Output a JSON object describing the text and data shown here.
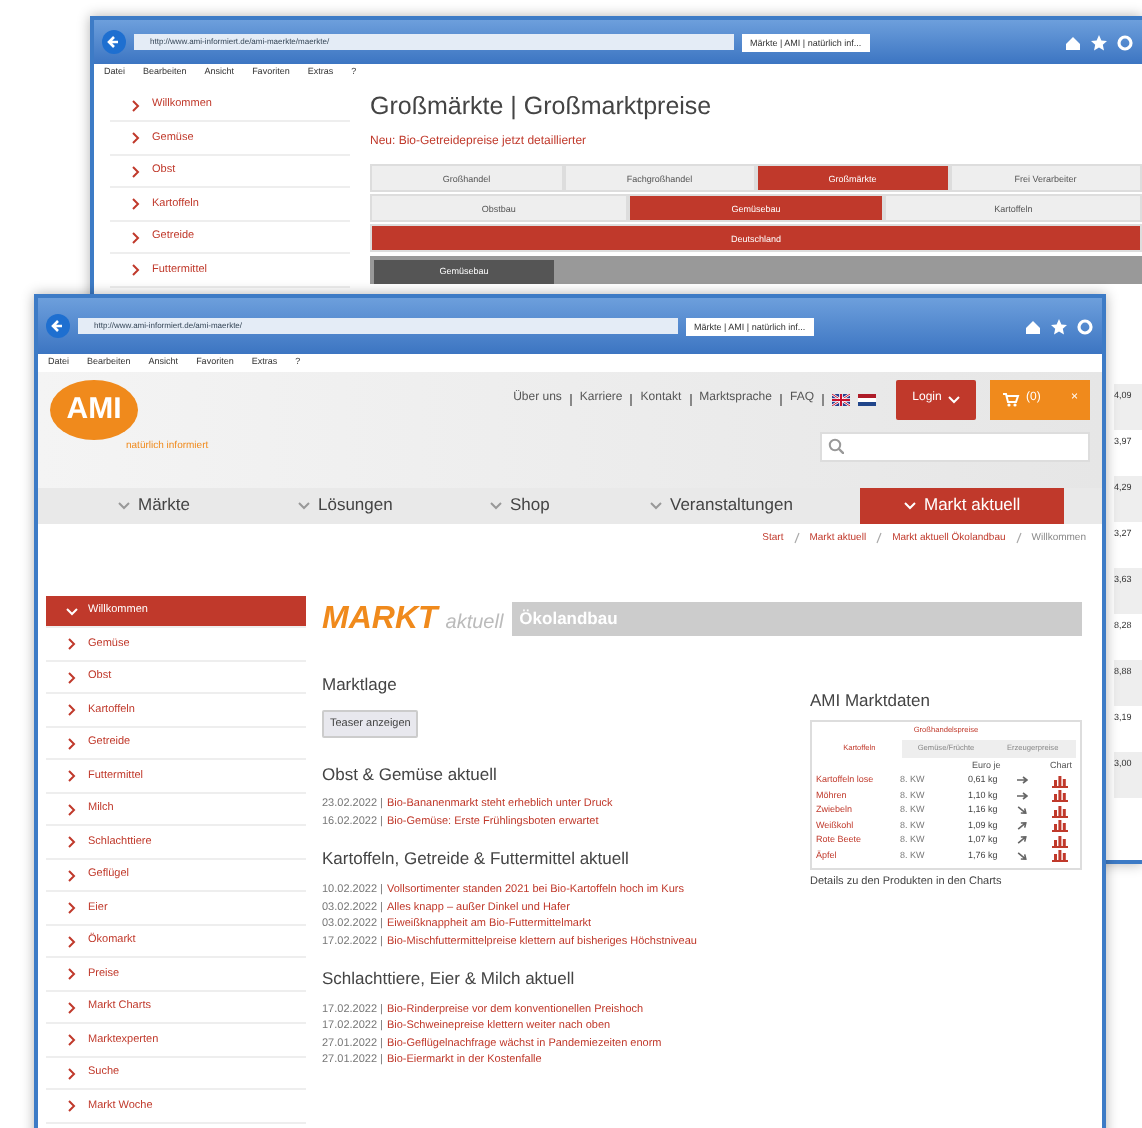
{
  "back_window": {
    "address": "http://www.ami-informiert.de/ami-maerkte/maerkte/",
    "tab": "Märkte | AMI | natürlich inf...",
    "menu": [
      "Datei",
      "Bearbeiten",
      "Ansicht",
      "Favoriten",
      "Extras",
      "?"
    ],
    "sidebar": [
      "Willkommen",
      "Gemüse",
      "Obst",
      "Kartoffeln",
      "Getreide",
      "Futtermittel"
    ],
    "heading": "Großmärkte | Großmarktpreise",
    "notice": "Neu: Bio-Getreidepreise jetzt detaillierter",
    "tabs_row_1": [
      {
        "label": "Großhandel",
        "selected": false
      },
      {
        "label": "Fachgroßhandel",
        "selected": false
      },
      {
        "label": "Großmärkte",
        "selected": true
      },
      {
        "label": "Frei Verarbeiter",
        "selected": false
      }
    ],
    "tabs_row_2": [
      {
        "label": "Obstbau",
        "selected": false
      },
      {
        "label": "Gemüsebau",
        "selected": true
      },
      {
        "label": "Kartoffeln",
        "selected": false
      }
    ],
    "region_bar": "Deutschland",
    "sub_tab": "Gemüsebau",
    "column_values": [
      "4,09",
      "3,97",
      "4,29",
      "3,27",
      "3,63",
      "8,28",
      "8,88",
      "3,19",
      "3,00"
    ]
  },
  "front_window": {
    "address": "http://www.ami-informiert.de/ami-maerkte/",
    "tab": "Märkte | AMI | natürlich inf...",
    "menu": [
      "Datei",
      "Bearbeiten",
      "Ansicht",
      "Favoriten",
      "Extras",
      "?"
    ],
    "logo": "AMI",
    "tagline": "natürlich informiert",
    "top_links": [
      "Über uns",
      "Karriere",
      "Kontakt",
      "Marktsprache",
      "FAQ"
    ],
    "login": "Login",
    "cart": "(0)",
    "cart_close": "×",
    "nav": [
      {
        "label": "Märkte",
        "selected": false
      },
      {
        "label": "Lösungen",
        "selected": false
      },
      {
        "label": "Shop",
        "selected": false
      },
      {
        "label": "Veranstaltungen",
        "selected": false
      },
      {
        "label": "Markt aktuell",
        "selected": true
      }
    ],
    "breadcrumb": [
      "Start",
      "Markt aktuell",
      "Markt aktuell Ökolandbau",
      "Willkommen"
    ],
    "sidebar": [
      {
        "label": "Willkommen",
        "selected": true
      },
      {
        "label": "Gemüse",
        "selected": false
      },
      {
        "label": "Obst",
        "selected": false
      },
      {
        "label": "Kartoffeln",
        "selected": false
      },
      {
        "label": "Getreide",
        "selected": false
      },
      {
        "label": "Futtermittel",
        "selected": false
      },
      {
        "label": "Milch",
        "selected": false
      },
      {
        "label": "Schlachttiere",
        "selected": false
      },
      {
        "label": "Geflügel",
        "selected": false
      },
      {
        "label": "Eier",
        "selected": false
      },
      {
        "label": "Ökomarkt",
        "selected": false
      },
      {
        "label": "Preise",
        "selected": false
      },
      {
        "label": "Markt Charts",
        "selected": false
      },
      {
        "label": "Marktexperten",
        "selected": false
      },
      {
        "label": "Suche",
        "selected": false
      },
      {
        "label": "Markt Woche",
        "selected": false
      }
    ],
    "banner": {
      "title": "MARKT",
      "subtitle": "aktuell",
      "section": "Ökolandbau"
    },
    "marktlage": "Marktlage",
    "teaser_button": "Teaser anzeigen",
    "news_sections": [
      {
        "heading": "Obst & Gemüse aktuell",
        "items": [
          {
            "date": "23.02.2022 |",
            "title": "Bio-Bananenmarkt steht erheblich unter Druck"
          },
          {
            "date": "16.02.2022 |",
            "title": "Bio-Gemüse: Erste Frühlingsboten erwartet"
          }
        ]
      },
      {
        "heading": "Kartoffeln, Getreide & Futtermittel aktuell",
        "items": [
          {
            "date": "10.02.2022 |",
            "title": "Vollsortimenter standen 2021 bei Bio-Kartoffeln hoch im Kurs"
          },
          {
            "date": "03.02.2022 |",
            "title": "Alles knapp – außer Dinkel und Hafer"
          },
          {
            "date": "03.02.2022 |",
            "title": "Eiweißknappheit am Bio-Futtermittelmarkt"
          },
          {
            "date": "17.02.2022 |",
            "title": "Bio-Mischfuttermittelpreise klettern auf bisheriges Höchstniveau"
          }
        ]
      },
      {
        "heading": "Schlachttiere, Eier & Milch aktuell",
        "items": [
          {
            "date": "17.02.2022 |",
            "title": "Bio-Rinderpreise vor dem konventionellen Preishoch"
          },
          {
            "date": "17.02.2022 |",
            "title": "Bio-Schweinepreise klettern weiter nach oben"
          },
          {
            "date": "27.01.2022 |",
            "title": "Bio-Geflügelnachfrage wächst in Pandemiezeiten enorm"
          },
          {
            "date": "27.01.2022 |",
            "title": "Bio-Eiermarkt in der Kostenfalle"
          }
        ]
      }
    ],
    "marktdaten": {
      "title": "AMI Marktdaten",
      "header": "Großhandelspreise",
      "tabs": [
        {
          "label": "Kartoffeln",
          "selected": true
        },
        {
          "label": "Gemüse/Früchte",
          "selected": false
        },
        {
          "label": "Erzeugerpreise",
          "selected": false
        }
      ],
      "columns": [
        "Euro je",
        "Chart"
      ],
      "rows": [
        {
          "product": "Kartoffeln lose",
          "week": "8. KW",
          "price": "0,61 kg",
          "kind": "steady"
        },
        {
          "product": "Möhren",
          "week": "8. KW",
          "price": "1,10 kg",
          "kind": "steady"
        },
        {
          "product": "Zwiebeln",
          "week": "8. KW",
          "price": "1,16 kg",
          "kind": "falling"
        },
        {
          "product": "Weißkohl",
          "week": "8. KW",
          "price": "1,09 kg",
          "kind": "rising"
        },
        {
          "product": "Rote Beete",
          "week": "8. KW",
          "price": "1,07 kg",
          "kind": "rising"
        },
        {
          "product": "Äpfel",
          "week": "8. KW",
          "price": "1,76 kg",
          "kind": "falling"
        }
      ],
      "footer": "Details zu den Produkten in den Charts"
    }
  }
}
